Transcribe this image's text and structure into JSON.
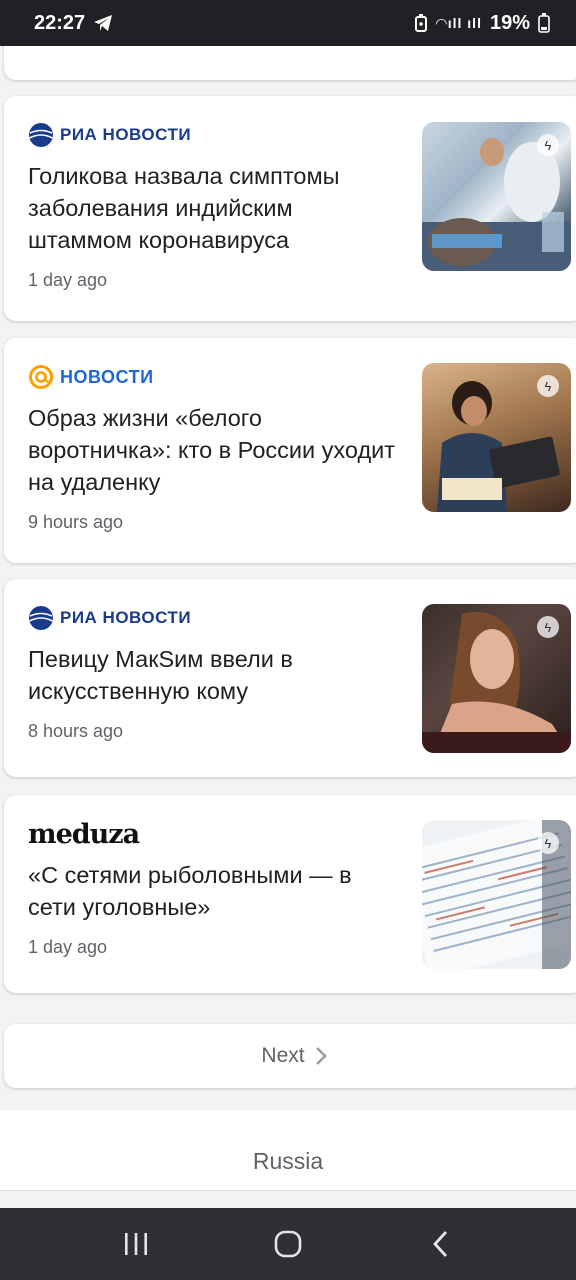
{
  "status_bar": {
    "time": "22:27",
    "battery": "19%"
  },
  "stories": [
    {
      "source": "РИА НОВОСТИ",
      "headline": "Голикова назвала симптомы заболевания индийским штаммом коронавируса",
      "time": "1 day ago"
    },
    {
      "source": "НОВОСТИ",
      "headline": "Образ жизни «белого воротничка»: кто в России уходит на удаленку",
      "time": "9 hours ago"
    },
    {
      "source": "РИА НОВОСТИ",
      "headline": "Певицу МакSим ввели в искусственную кому",
      "time": "8 hours ago"
    },
    {
      "source": "meduza",
      "headline": "«С сетями рыболовными — в сети уголовные»",
      "time": "1 day ago"
    }
  ],
  "pagination": {
    "next_label": "Next"
  },
  "footer": {
    "region": "Russia"
  },
  "colors": {
    "ria": "#1a3b8c",
    "mail": "#1f67d8",
    "mail_at": "#ff9e00"
  }
}
